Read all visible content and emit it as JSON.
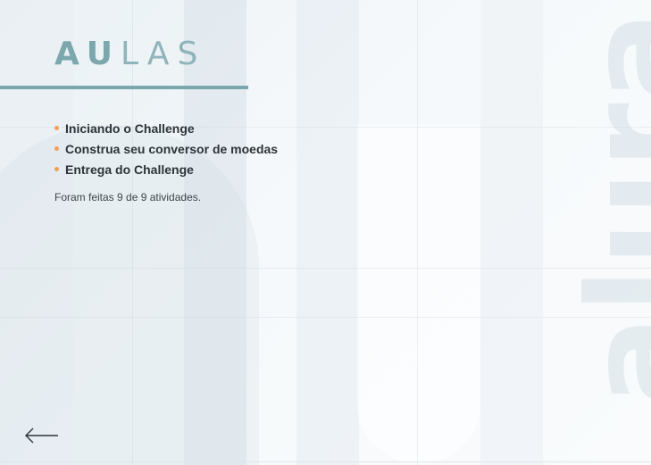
{
  "header": {
    "title_bold": "AU",
    "title_light": "LAS"
  },
  "lessons": [
    "Iniciando o Challenge",
    "Construa seu conversor de moedas",
    "Entrega do Challenge"
  ],
  "summary": "Foram feitas 9 de 9 atividades.",
  "watermark": "alura",
  "colors": {
    "accent": "#7aa7ad",
    "bullet": "#f0a058",
    "text": "#2d3438"
  },
  "icons": {
    "back": "arrow-left-icon"
  }
}
